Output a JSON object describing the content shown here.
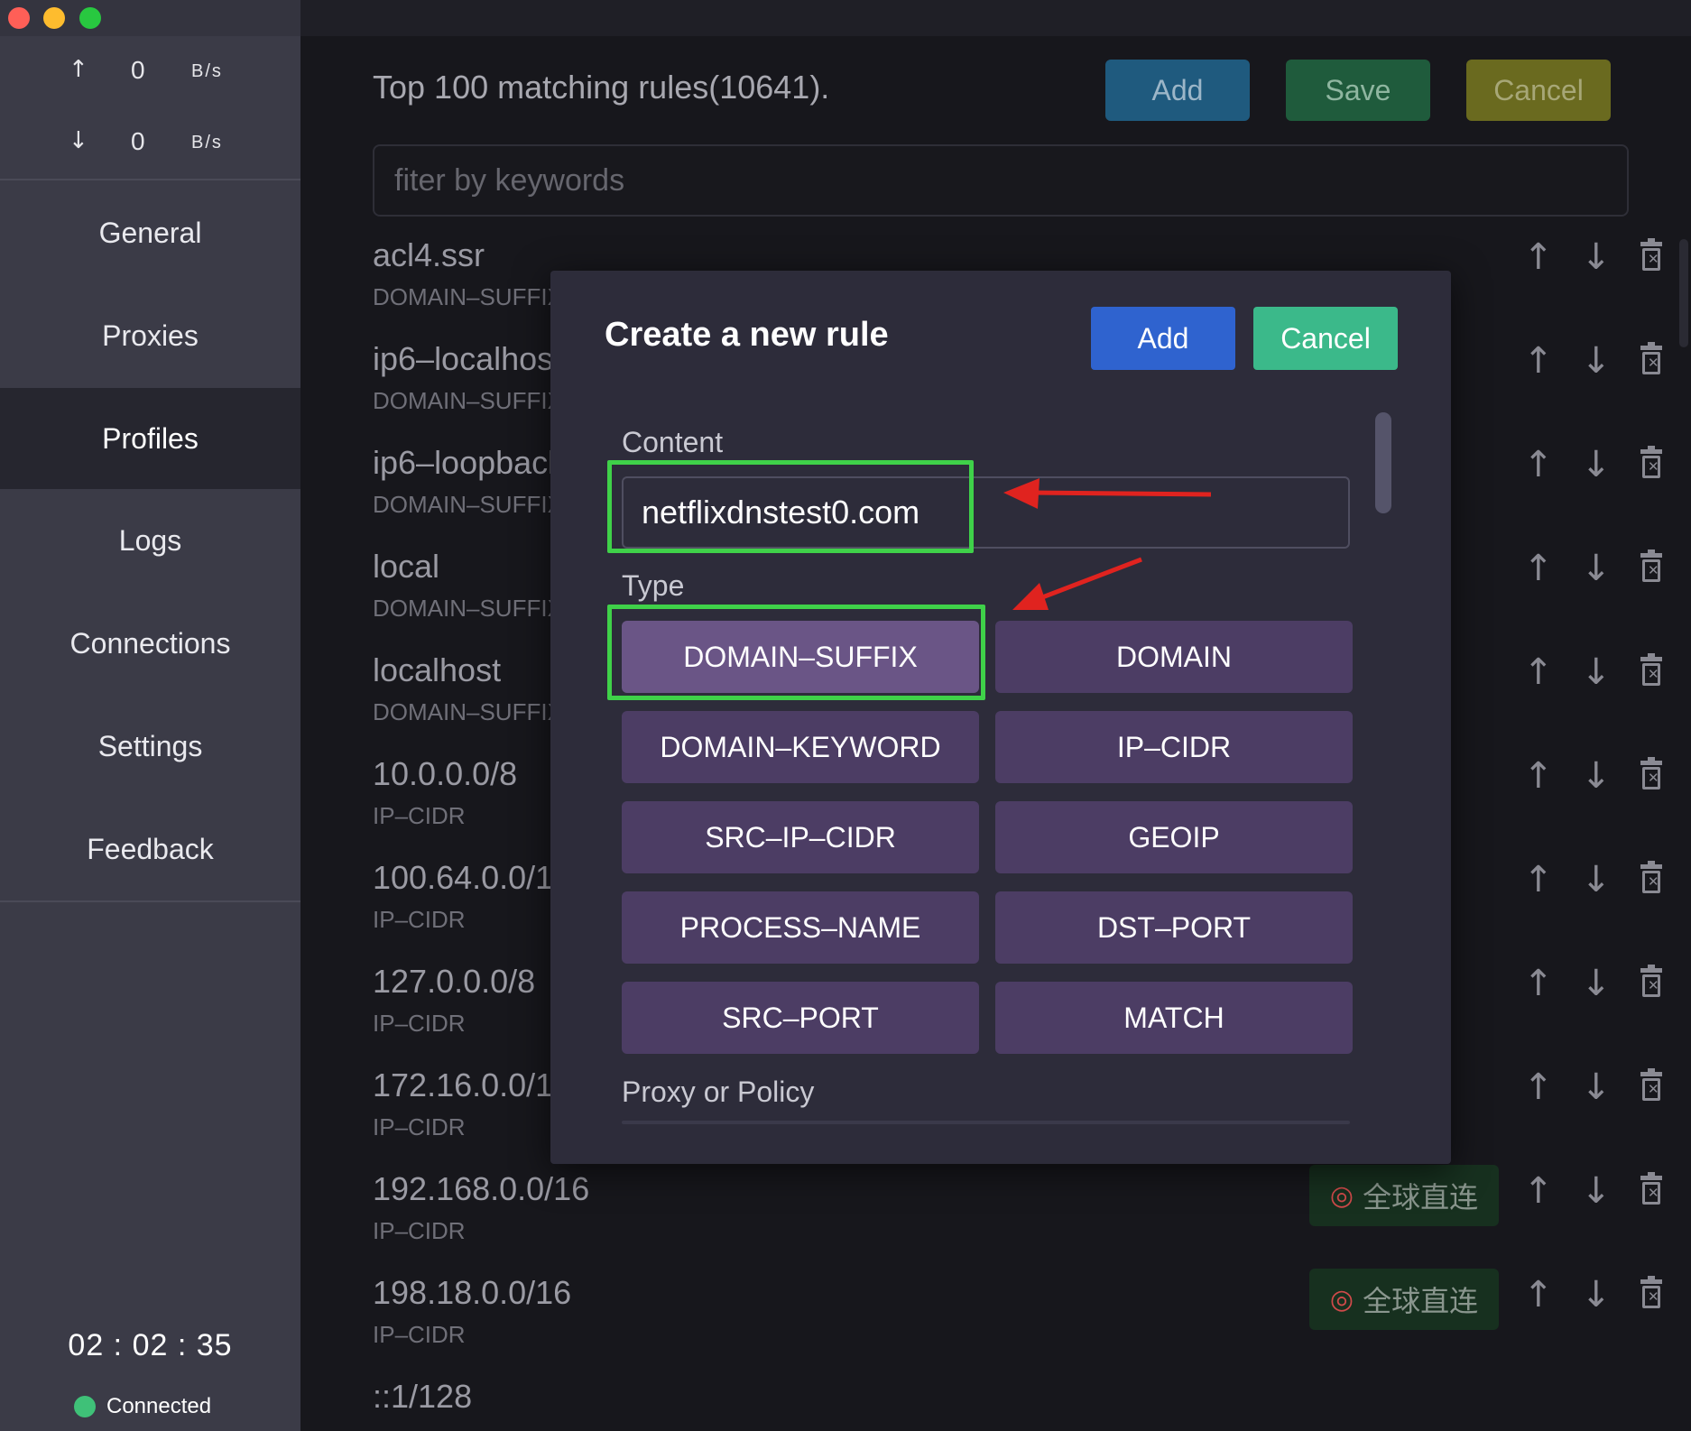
{
  "window": {
    "traffic_lights": [
      "close",
      "minimize",
      "maximize"
    ]
  },
  "sidebar": {
    "upload": {
      "arrow": "↑",
      "value": "0",
      "unit": "B/s"
    },
    "download": {
      "arrow": "↓",
      "value": "0",
      "unit": "B/s"
    },
    "items": [
      {
        "label": "General",
        "active": false
      },
      {
        "label": "Proxies",
        "active": false
      },
      {
        "label": "Profiles",
        "active": true
      },
      {
        "label": "Logs",
        "active": false
      },
      {
        "label": "Connections",
        "active": false
      },
      {
        "label": "Settings",
        "active": false
      },
      {
        "label": "Feedback",
        "active": false
      }
    ],
    "clock": "02 : 02 : 35",
    "status": {
      "label": "Connected",
      "color": "#3fc178"
    }
  },
  "main": {
    "title": "Top 100 matching rules(10641).",
    "buttons": {
      "add": "Add",
      "save": "Save",
      "cancel": "Cancel"
    },
    "filter_placeholder": "fiter by keywords",
    "rules": [
      {
        "name": "acl4.ssr",
        "type": "DOMAIN–SUFFIX"
      },
      {
        "name": "ip6–localhost",
        "type": "DOMAIN–SUFFIX"
      },
      {
        "name": "ip6–loopback",
        "type": "DOMAIN–SUFFIX"
      },
      {
        "name": "local",
        "type": "DOMAIN–SUFFIX"
      },
      {
        "name": "localhost",
        "type": "DOMAIN–SUFFIX"
      },
      {
        "name": "10.0.0.0/8",
        "type": "IP–CIDR"
      },
      {
        "name": "100.64.0.0/10",
        "type": "IP–CIDR"
      },
      {
        "name": "127.0.0.0/8",
        "type": "IP–CIDR"
      },
      {
        "name": "172.16.0.0/12",
        "type": "IP–CIDR"
      },
      {
        "name": "192.168.0.0/16",
        "type": "IP–CIDR",
        "policy": "全球直连"
      },
      {
        "name": "198.18.0.0/16",
        "type": "IP–CIDR",
        "policy": "全球直连"
      },
      {
        "name": "::1/128",
        "type": ""
      }
    ],
    "row_controls": {
      "up": "↑",
      "down": "↓"
    }
  },
  "modal": {
    "title": "Create a new rule",
    "add_label": "Add",
    "cancel_label": "Cancel",
    "content_label": "Content",
    "content_value": "netflixdnstest0.com",
    "type_label": "Type",
    "types": [
      {
        "label": "DOMAIN–SUFFIX",
        "selected": true
      },
      {
        "label": "DOMAIN",
        "selected": false
      },
      {
        "label": "DOMAIN–KEYWORD",
        "selected": false
      },
      {
        "label": "IP–CIDR",
        "selected": false
      },
      {
        "label": "SRC–IP–CIDR",
        "selected": false
      },
      {
        "label": "GEOIP",
        "selected": false
      },
      {
        "label": "PROCESS–NAME",
        "selected": false
      },
      {
        "label": "DST–PORT",
        "selected": false
      },
      {
        "label": "SRC–PORT",
        "selected": false
      },
      {
        "label": "MATCH",
        "selected": false
      }
    ],
    "policy_label": "Proxy or Policy"
  },
  "annotations": {
    "highlight_color": "#3fd149",
    "arrow_color": "#e0231f"
  }
}
